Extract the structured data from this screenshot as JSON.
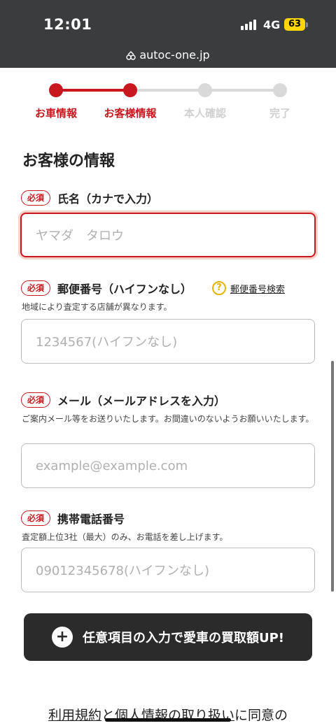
{
  "status": {
    "time": "12:01",
    "network": "4G",
    "battery": "63"
  },
  "browser": {
    "url": "autoc-one.jp"
  },
  "stepper": {
    "steps": [
      {
        "label": "お車情報",
        "state": "done"
      },
      {
        "label": "お客様情報",
        "state": "current"
      },
      {
        "label": "本人確認",
        "state": "todo"
      },
      {
        "label": "完了",
        "state": "todo"
      }
    ]
  },
  "section_title": "お客様の情報",
  "required_badge": "必須",
  "fields": {
    "name": {
      "label": "氏名（カナで入力）",
      "placeholder": "ヤマダ　タロウ"
    },
    "zip": {
      "label": "郵便番号（ハイフンなし）",
      "help_link": "郵便番号検索",
      "hint": "地域により査定する店舗が異なります。",
      "placeholder": "1234567(ハイフンなし)"
    },
    "email": {
      "label": "メール（メールアドレスを入力）",
      "hint": "ご案内メール等をお送りいたします。お間違いのないようお願いいたします。",
      "placeholder": "example@example.com"
    },
    "phone": {
      "label": "携帯電話番号",
      "hint": "査定額上位3社（最大）のみ、お電話を差し上げます。",
      "placeholder": "09012345678(ハイフンなし)"
    }
  },
  "cta": {
    "label": "任意項目の入力で愛車の買取額UP!"
  },
  "terms": {
    "link1": "利用規約",
    "mid": "と",
    "link2": "個人情報の取り扱い",
    "tail": "に同意の"
  },
  "colors": {
    "accent": "#c8171e",
    "inactive": "#d9d9d9",
    "dark": "#2b2b2b",
    "help": "#e2b400"
  }
}
